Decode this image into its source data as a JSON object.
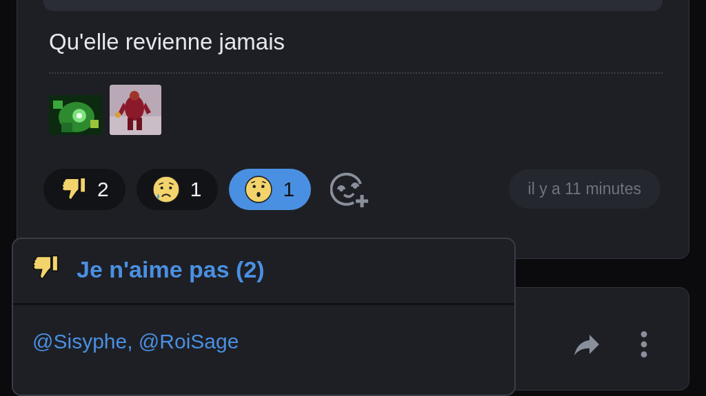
{
  "post": {
    "text": "Qu'elle revienne jamais",
    "reactions": [
      {
        "kind": "thumbs-down",
        "count": "2",
        "selected": false
      },
      {
        "kind": "sad",
        "count": "1",
        "selected": false
      },
      {
        "kind": "surprised",
        "count": "1",
        "selected": true
      }
    ],
    "timestamp": "il y a 11 minutes"
  },
  "popup": {
    "kind": "thumbs-down",
    "title": "Je n'aime pas (2)",
    "users": "@Sisyphe, @RoiSage"
  }
}
